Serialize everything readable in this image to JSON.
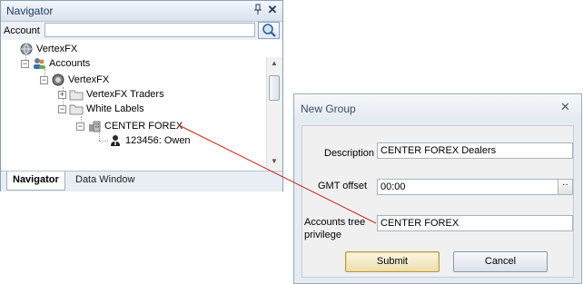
{
  "navigator": {
    "title": "Navigator",
    "pin_glyph": "ᵖ",
    "close_glyph": "✕",
    "account_label": "Account",
    "account_value": "",
    "tree": {
      "root": "VertexFX",
      "accounts": "Accounts",
      "server": "VertexFX",
      "traders": "VertexFX Traders",
      "white_labels": "White Labels",
      "group": "CENTER FOREX",
      "account": "123456: Owen"
    },
    "tabs": [
      "Navigator",
      "Data Window"
    ]
  },
  "dialog": {
    "title": "New Group",
    "close_glyph": "✕",
    "description_label": "Description",
    "description_value": "CENTER FOREX Dealers",
    "gmt_label": "GMT offset",
    "gmt_value": "00:00",
    "gmt_button": "··",
    "privilege_label_1": "Accounts tree",
    "privilege_label_2": "privilege",
    "privilege_value": "CENTER FOREX",
    "submit": "Submit",
    "cancel": "Cancel"
  },
  "colors": {
    "connector": "#c8201e",
    "accent": "#1e3a60"
  },
  "icons": [
    "globe-icon",
    "users-icon",
    "server-icon",
    "folder-icon",
    "building-icon",
    "person-icon",
    "magnifier-icon",
    "pin-icon",
    "close-icon"
  ]
}
